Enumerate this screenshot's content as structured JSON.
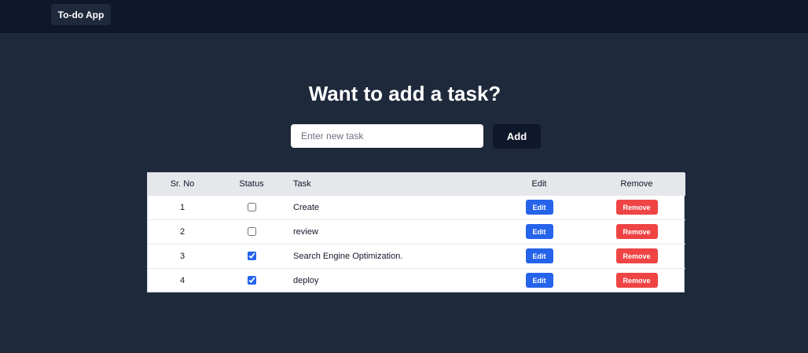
{
  "navbar": {
    "brand": "To-do App"
  },
  "main": {
    "heading": "Want to add a task?",
    "input": {
      "placeholder": "Enter new task",
      "value": ""
    },
    "add_label": "Add"
  },
  "table": {
    "headers": {
      "sr": "Sr. No",
      "status": "Status",
      "task": "Task",
      "edit": "Edit",
      "remove": "Remove"
    },
    "rows": [
      {
        "sr": "1",
        "done": false,
        "task": "Create",
        "edit_label": "Edit",
        "remove_label": "Remove"
      },
      {
        "sr": "2",
        "done": false,
        "task": "review",
        "edit_label": "Edit",
        "remove_label": "Remove"
      },
      {
        "sr": "3",
        "done": true,
        "task": "Search Engine Optimization.",
        "edit_label": "Edit",
        "remove_label": "Remove"
      },
      {
        "sr": "4",
        "done": true,
        "task": "deploy",
        "edit_label": "Edit",
        "remove_label": "Remove"
      }
    ]
  },
  "colors": {
    "page_bg": "#1e293b",
    "navbar_bg": "#0f172a",
    "edit_button": "#2563eb",
    "remove_button": "#ef4444"
  }
}
